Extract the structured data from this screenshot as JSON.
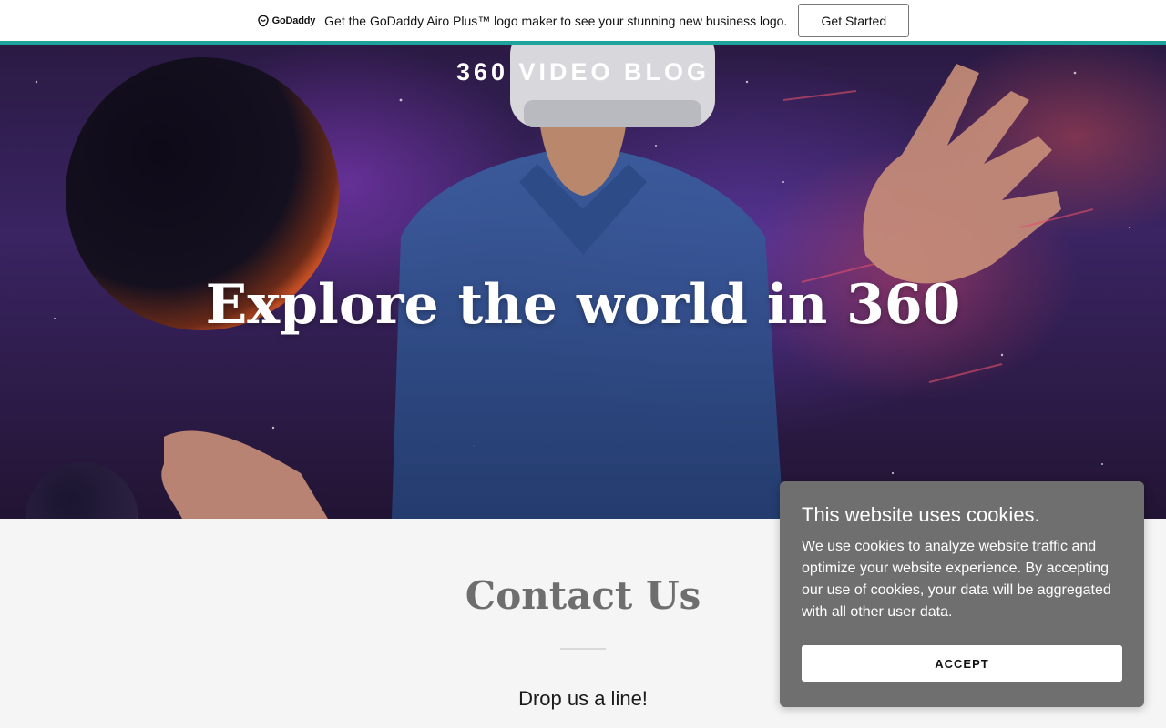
{
  "promo": {
    "logo_text": "GoDaddy",
    "message": "Get the GoDaddy Airo Plus™ logo maker to see your stunning new business logo.",
    "button_label": "Get Started",
    "accent_color": "#1ba39c"
  },
  "hero": {
    "site_title": "360 VIDEO BLOG",
    "heading": "Explore the world in 360"
  },
  "contact": {
    "title": "Contact Us",
    "subtitle": "Drop us a line!"
  },
  "cookie": {
    "title": "This website uses cookies.",
    "body": "We use cookies to analyze website traffic and optimize your website experience. By accepting our use of cookies, your data will be aggregated with all other user data.",
    "accept_label": "ACCEPT",
    "background_color": "#6f6f6f"
  }
}
